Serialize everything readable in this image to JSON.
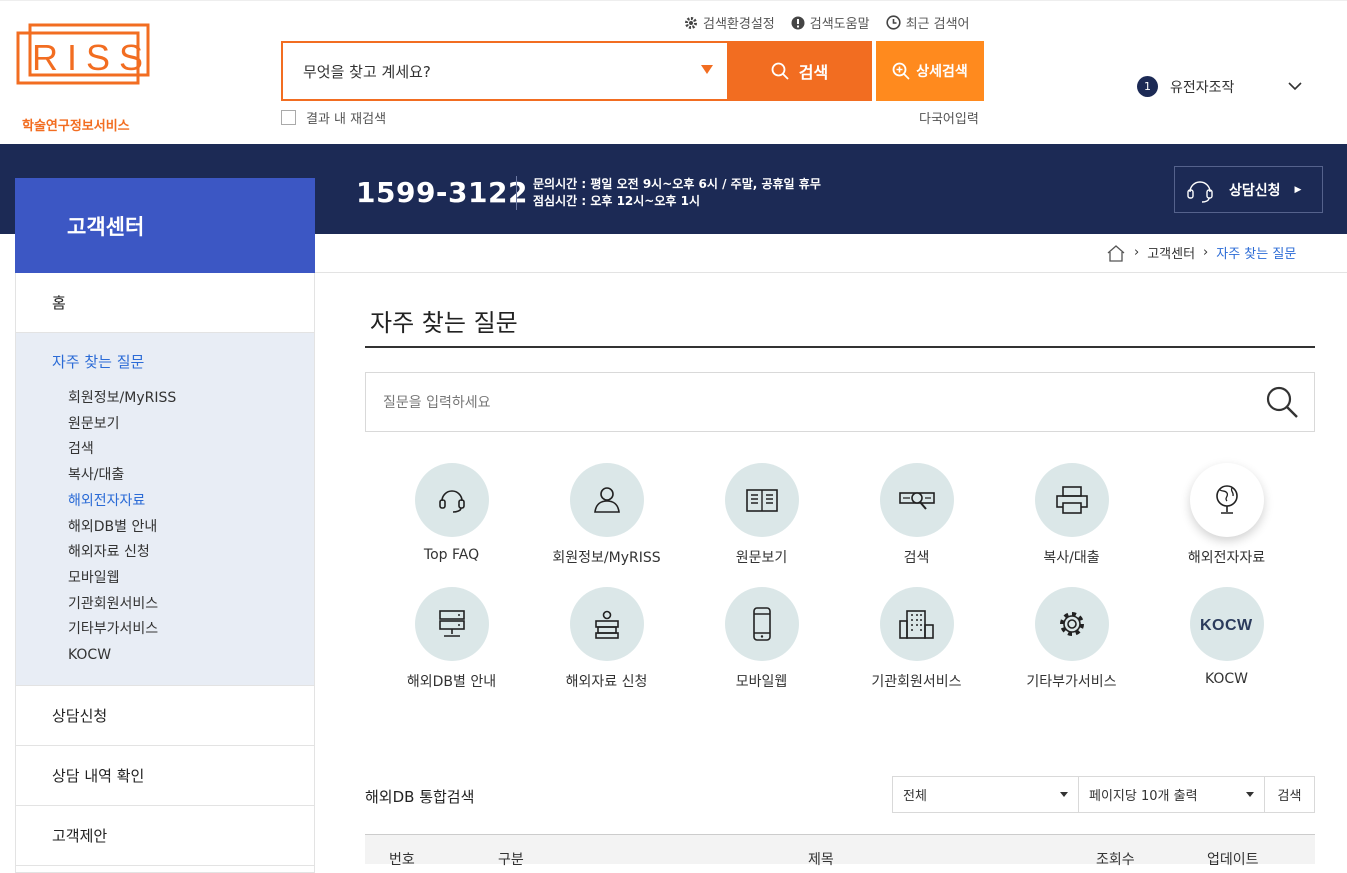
{
  "brand": {
    "logo_text": "RISS",
    "service_name": "학술연구정보서비스",
    "color": "#f26d21"
  },
  "topmenu": [
    {
      "label": "검색환경설정",
      "icon": "gear-icon"
    },
    {
      "label": "검색도움말",
      "icon": "info-icon"
    },
    {
      "label": "최근 검색어",
      "icon": "clock-icon"
    }
  ],
  "search": {
    "value": "무엇을 찾고 계세요?",
    "button": "검색",
    "advanced": "상세검색",
    "research": "결과 내 재검색",
    "multilang": "다국어입력"
  },
  "user": {
    "badge": "1",
    "name": "유전자조작"
  },
  "help": {
    "side_title": "고객센터",
    "phone": "1599-3122",
    "hours1": "문의시간 : 평일 오전 9시~오후 6시 / 주말, 공휴일 휴무",
    "hours2": "점심시간 : 오후 12시~오후 1시",
    "consult": "상담신청"
  },
  "breadcrumb": {
    "level1": "고객센터",
    "current": "자주 찾는 질문"
  },
  "sidebar": {
    "home": "홈",
    "faq": "자주 찾는 질문",
    "subs": [
      "회원정보/MyRISS",
      "원문보기",
      "검색",
      "복사/대출",
      "해외전자자료",
      "해외DB별 안내",
      "해외자료 신청",
      "모바일웹",
      "기관회원서비스",
      "기타부가서비스",
      "KOCW"
    ],
    "consult": "상담신청",
    "history": "상담 내역 확인",
    "suggest": "고객제안"
  },
  "main": {
    "title": "자주 찾는 질문",
    "placeholder": "질문을 입력하세요"
  },
  "categories": [
    {
      "label": "Top FAQ",
      "icon": "headset-icon"
    },
    {
      "label": "회원정보/MyRISS",
      "icon": "user-icon"
    },
    {
      "label": "원문보기",
      "icon": "book-icon"
    },
    {
      "label": "검색",
      "icon": "search-doc-icon"
    },
    {
      "label": "복사/대출",
      "icon": "printer-icon"
    },
    {
      "label": "해외전자자료",
      "icon": "globe-icon"
    },
    {
      "label": "해외DB별 안내",
      "icon": "server-icon"
    },
    {
      "label": "해외자료 신청",
      "icon": "books-icon"
    },
    {
      "label": "모바일웹",
      "icon": "mobile-icon"
    },
    {
      "label": "기관회원서비스",
      "icon": "building-icon"
    },
    {
      "label": "기타부가서비스",
      "icon": "settings-icon"
    },
    {
      "label": "KOCW",
      "icon": "kocw-logo-icon"
    }
  ],
  "db": {
    "title": "해외DB 통합검색",
    "filter": "전체",
    "perpage": "페이지당 10개 출력",
    "button": "검색",
    "columns": [
      "번호",
      "구분",
      "제목",
      "조회수",
      "업데이트"
    ]
  }
}
